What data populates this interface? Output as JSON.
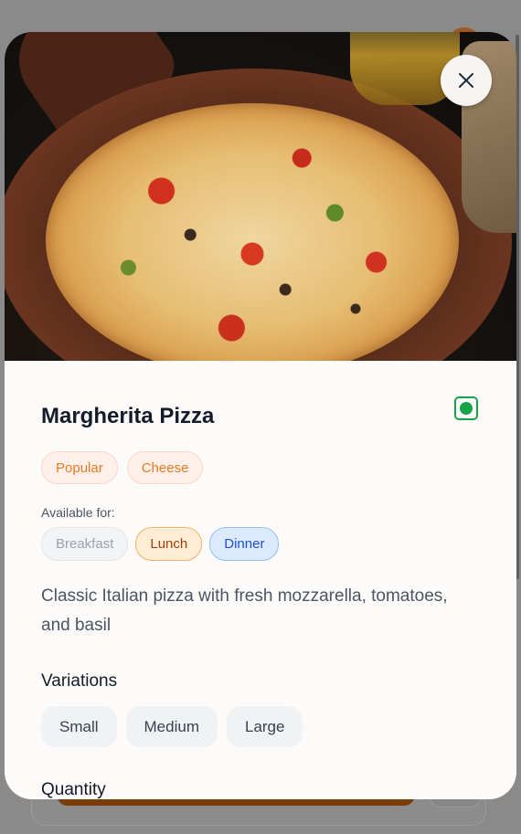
{
  "item": {
    "title": "Margherita Pizza",
    "tags": [
      "Popular",
      "Cheese"
    ],
    "available_label": "Available for:",
    "meals": {
      "breakfast": "Breakfast",
      "lunch": "Lunch",
      "dinner": "Dinner"
    },
    "description": "Classic Italian pizza with fresh mozzarella, tomatoes, and basil",
    "variations_title": "Variations",
    "variations": [
      "Small",
      "Medium",
      "Large"
    ],
    "quantity_title": "Quantity"
  },
  "icons": {
    "close": "close-icon",
    "veg": "veg-indicator-icon"
  },
  "colors": {
    "veg": "#16a34a",
    "tag_text": "#ea7a1e",
    "lunch_text": "#9a3f0c",
    "dinner_text": "#1e4fd8"
  }
}
